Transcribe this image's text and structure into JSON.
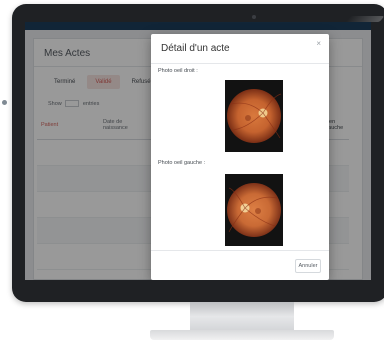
{
  "app": {
    "panel_title": "Mes Actes",
    "tabs": [
      {
        "label": "Terminé",
        "active": false
      },
      {
        "label": "Validé",
        "active": true
      },
      {
        "label": "Refusé",
        "active": false
      }
    ],
    "show_entries": {
      "prefix": "Show",
      "value": "",
      "suffix": "entries"
    },
    "table": {
      "headers": [
        "Patient",
        "Date de naissance",
        "",
        "Examen oeil gauche"
      ],
      "rows": [
        {
          "patient": "",
          "date": "",
          "result": ""
        },
        {
          "patient": "",
          "date": "",
          "result": ""
        },
        {
          "patient": "",
          "date": "",
          "result": ""
        },
        {
          "patient": "",
          "date": "",
          "result": ""
        },
        {
          "patient": "",
          "date": "",
          "result": ""
        }
      ]
    }
  },
  "modal": {
    "title": "Détail d'un acte",
    "right_eye_label": "Photo oeil droit :",
    "left_eye_label": "Photo oeil gauche :",
    "cancel_label": "Annuler",
    "close_icon": "×"
  },
  "colors": {
    "topbar": "#1d3f5c",
    "accent": "#d4675f",
    "fundus": "#c5632f"
  },
  "icons": {
    "close": "close-icon",
    "sort": "sort-icon"
  }
}
